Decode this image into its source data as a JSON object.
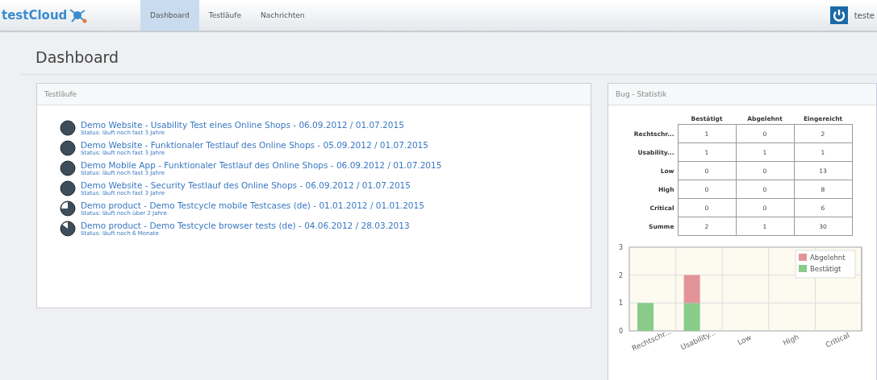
{
  "logo": {
    "text": "testCloud"
  },
  "nav": [
    {
      "label": "Dashboard",
      "selected": true
    },
    {
      "label": "Testläufe",
      "selected": false
    },
    {
      "label": "Nachrichten",
      "selected": false
    }
  ],
  "user": {
    "name": "teste"
  },
  "page_title": "Dashboard",
  "testruns": {
    "title": "Testläufe",
    "items": [
      {
        "title": "Demo Website - Usability Test eines Online Shops - 06.09.2012 / 01.07.2015",
        "status": "Status: läuft noch fast 3 Jahre",
        "kind": "full"
      },
      {
        "title": "Demo Website - Funktionaler Testlauf des Online Shops - 05.09.2012 / 01.07.2015",
        "status": "Status: läuft noch fast 3 Jahre",
        "kind": "full"
      },
      {
        "title": "Demo Mobile App - Funktionaler Testlauf des Online Shops - 06.09.2012 / 01.07.2015",
        "status": "Status: läuft noch fast 3 Jahre",
        "kind": "full"
      },
      {
        "title": "Demo Website - Security Testlauf des Online Shops - 06.09.2012 / 01.07.2015",
        "status": "Status: läuft noch fast 3 Jahre",
        "kind": "full"
      },
      {
        "title": "Demo product - Demo Testcycle mobile Testcases (de) - 01.01.2012 / 01.01.2015",
        "status": "Status: läuft noch über 2 Jahre",
        "kind": "quarter"
      },
      {
        "title": "Demo product - Demo Testcycle browser tests (de) - 04.06.2012 / 28.03.2013",
        "status": "Status: läuft noch 6 Monate",
        "kind": "sliver"
      }
    ]
  },
  "bugs": {
    "title": "Bug - Statistik",
    "columns": [
      "Bestätigt",
      "Abgelehnt",
      "Eingereicht"
    ],
    "rows": [
      {
        "label": "Rechtschr...",
        "cells": [
          "1",
          "0",
          "2"
        ]
      },
      {
        "label": "Usability...",
        "cells": [
          "1",
          "1",
          "1"
        ]
      },
      {
        "label": "Low",
        "cells": [
          "0",
          "0",
          "13"
        ]
      },
      {
        "label": "High",
        "cells": [
          "0",
          "0",
          "8"
        ]
      },
      {
        "label": "Critical",
        "cells": [
          "0",
          "0",
          "6"
        ]
      },
      {
        "label": "Summe",
        "cells": [
          "2",
          "1",
          "30"
        ]
      }
    ],
    "chart_data": {
      "type": "bar",
      "stacked": true,
      "categories": [
        "Rechtschr...",
        "Usability...",
        "Low",
        "High",
        "Critical"
      ],
      "series": [
        {
          "name": "Bestätigt",
          "color": "#88cc88",
          "values": [
            1,
            1,
            0,
            0,
            0
          ]
        },
        {
          "name": "Abgelehnt",
          "color": "#e39499",
          "values": [
            0,
            1,
            0,
            0,
            0
          ]
        }
      ],
      "legend": true,
      "ylim": [
        0,
        3
      ],
      "yticks": [
        0,
        1,
        2,
        3
      ]
    }
  }
}
